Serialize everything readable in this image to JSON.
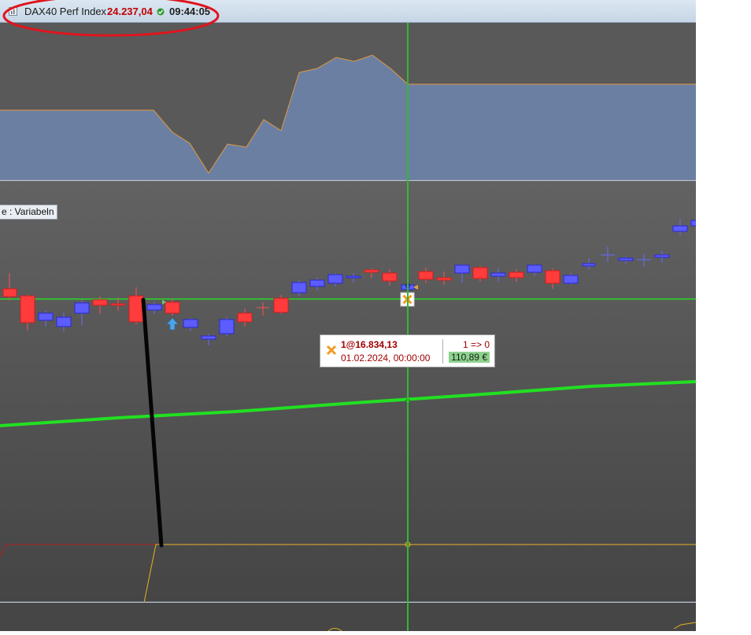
{
  "window": {
    "instrument": "DAX40 Perf Index",
    "price": "24.237,04",
    "time": "09:44:05",
    "chart_icon": "chart-window-icon",
    "status_icon": "connection-status-icon"
  },
  "indicator_label": "e : Variabeln",
  "trade_tooltip": {
    "order": "1@16.834,13",
    "datetime": "01.02.2024, 00:00:00",
    "position": "1 => 0",
    "pnl": "110,89 €",
    "icon": "trade-cross-icon"
  },
  "colors": {
    "panel_bg": "#575757",
    "crosshair": "#33b833",
    "moving_average": "#22e022",
    "candle_up": "#5c5cff",
    "candle_down": "#ff3b3b",
    "area_fill": "#6b7fa3",
    "area_line": "#e09a40",
    "annotation_ellipse": "#e0141e",
    "level_line": "#e6b422"
  },
  "icons": {
    "entry_arrow": "up-arrow-icon",
    "trade_marker": "trade-cross-icon"
  }
}
